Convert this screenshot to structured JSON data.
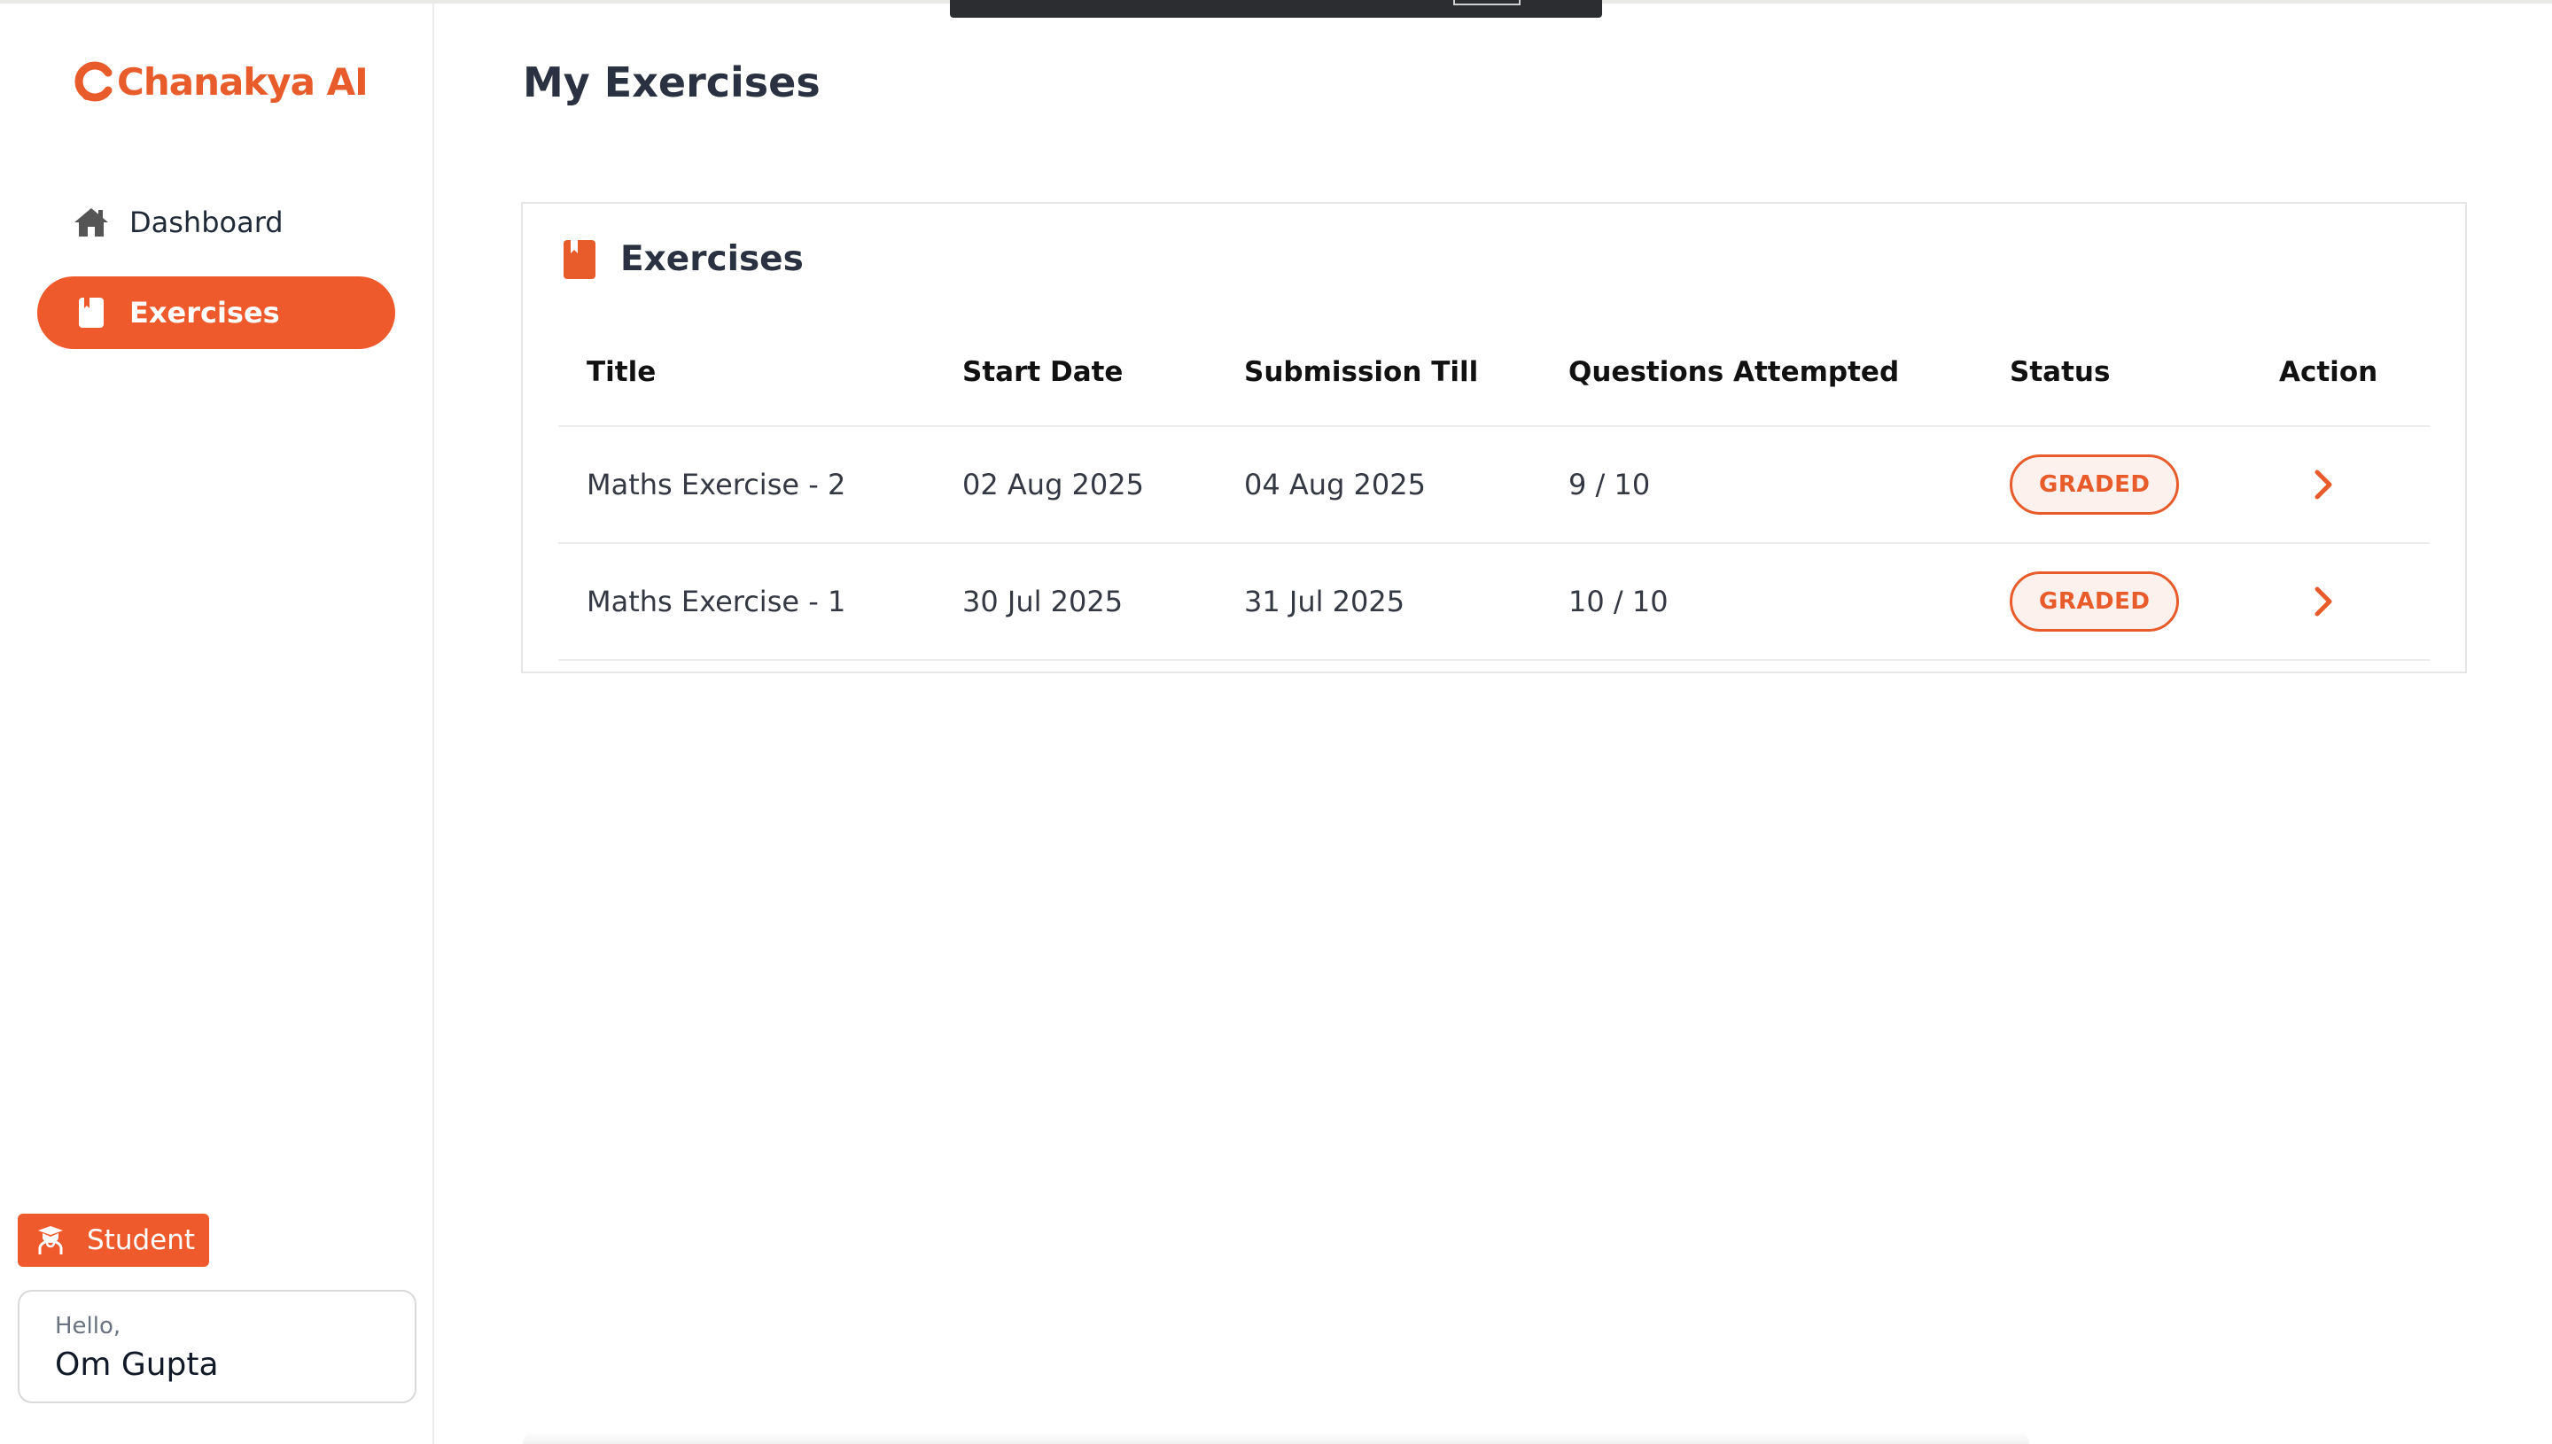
{
  "brand": {
    "name": "Chanakya AI",
    "color": "#e85b2a"
  },
  "sidebar": {
    "items": [
      {
        "label": "Dashboard",
        "icon": "home-icon",
        "active": false
      },
      {
        "label": "Exercises",
        "icon": "book-icon",
        "active": true
      }
    ],
    "role": {
      "label": "Student",
      "icon": "teacher-icon"
    },
    "user": {
      "greeting": "Hello,",
      "name": "Om Gupta"
    }
  },
  "main": {
    "title": "My Exercises",
    "card": {
      "title": "Exercises",
      "icon": "book-icon",
      "columns": [
        "Title",
        "Start Date",
        "Submission Till",
        "Questions Attempted",
        "Status",
        "Action"
      ],
      "rows": [
        {
          "title": "Maths Exercise - 2",
          "start": "02 Aug 2025",
          "submission": "04 Aug 2025",
          "attempted": "9 / 10",
          "status": "GRADED",
          "action": "chevron-right-icon"
        },
        {
          "title": "Maths Exercise - 1",
          "start": "30 Jul 2025",
          "submission": "31 Jul 2025",
          "attempted": "10 / 10",
          "status": "GRADED",
          "action": "chevron-right-icon"
        }
      ]
    }
  },
  "colors": {
    "accent": "#ee5a2b",
    "status_bg": "#fdf1ed",
    "text": "#2a3140"
  }
}
